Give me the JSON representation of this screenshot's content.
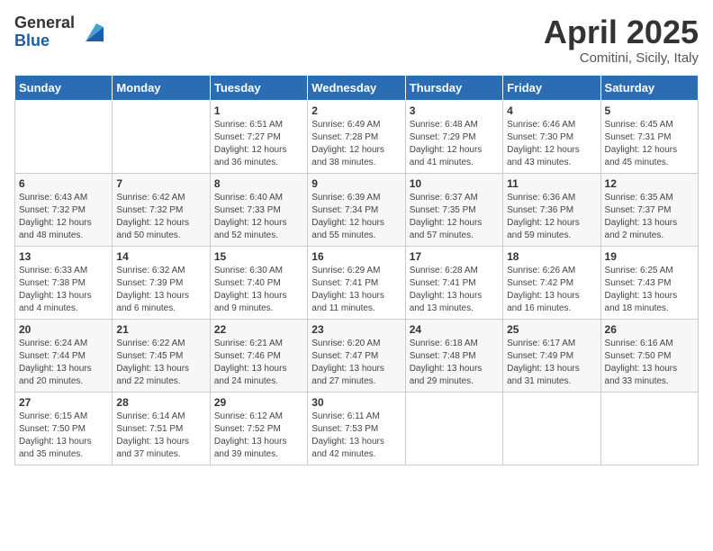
{
  "header": {
    "logo_general": "General",
    "logo_blue": "Blue",
    "month_title": "April 2025",
    "location": "Comitini, Sicily, Italy"
  },
  "days_of_week": [
    "Sunday",
    "Monday",
    "Tuesday",
    "Wednesday",
    "Thursday",
    "Friday",
    "Saturday"
  ],
  "weeks": [
    [
      {
        "day": "",
        "info": ""
      },
      {
        "day": "",
        "info": ""
      },
      {
        "day": "1",
        "info": "Sunrise: 6:51 AM\nSunset: 7:27 PM\nDaylight: 12 hours and 36 minutes."
      },
      {
        "day": "2",
        "info": "Sunrise: 6:49 AM\nSunset: 7:28 PM\nDaylight: 12 hours and 38 minutes."
      },
      {
        "day": "3",
        "info": "Sunrise: 6:48 AM\nSunset: 7:29 PM\nDaylight: 12 hours and 41 minutes."
      },
      {
        "day": "4",
        "info": "Sunrise: 6:46 AM\nSunset: 7:30 PM\nDaylight: 12 hours and 43 minutes."
      },
      {
        "day": "5",
        "info": "Sunrise: 6:45 AM\nSunset: 7:31 PM\nDaylight: 12 hours and 45 minutes."
      }
    ],
    [
      {
        "day": "6",
        "info": "Sunrise: 6:43 AM\nSunset: 7:32 PM\nDaylight: 12 hours and 48 minutes."
      },
      {
        "day": "7",
        "info": "Sunrise: 6:42 AM\nSunset: 7:32 PM\nDaylight: 12 hours and 50 minutes."
      },
      {
        "day": "8",
        "info": "Sunrise: 6:40 AM\nSunset: 7:33 PM\nDaylight: 12 hours and 52 minutes."
      },
      {
        "day": "9",
        "info": "Sunrise: 6:39 AM\nSunset: 7:34 PM\nDaylight: 12 hours and 55 minutes."
      },
      {
        "day": "10",
        "info": "Sunrise: 6:37 AM\nSunset: 7:35 PM\nDaylight: 12 hours and 57 minutes."
      },
      {
        "day": "11",
        "info": "Sunrise: 6:36 AM\nSunset: 7:36 PM\nDaylight: 12 hours and 59 minutes."
      },
      {
        "day": "12",
        "info": "Sunrise: 6:35 AM\nSunset: 7:37 PM\nDaylight: 13 hours and 2 minutes."
      }
    ],
    [
      {
        "day": "13",
        "info": "Sunrise: 6:33 AM\nSunset: 7:38 PM\nDaylight: 13 hours and 4 minutes."
      },
      {
        "day": "14",
        "info": "Sunrise: 6:32 AM\nSunset: 7:39 PM\nDaylight: 13 hours and 6 minutes."
      },
      {
        "day": "15",
        "info": "Sunrise: 6:30 AM\nSunset: 7:40 PM\nDaylight: 13 hours and 9 minutes."
      },
      {
        "day": "16",
        "info": "Sunrise: 6:29 AM\nSunset: 7:41 PM\nDaylight: 13 hours and 11 minutes."
      },
      {
        "day": "17",
        "info": "Sunrise: 6:28 AM\nSunset: 7:41 PM\nDaylight: 13 hours and 13 minutes."
      },
      {
        "day": "18",
        "info": "Sunrise: 6:26 AM\nSunset: 7:42 PM\nDaylight: 13 hours and 16 minutes."
      },
      {
        "day": "19",
        "info": "Sunrise: 6:25 AM\nSunset: 7:43 PM\nDaylight: 13 hours and 18 minutes."
      }
    ],
    [
      {
        "day": "20",
        "info": "Sunrise: 6:24 AM\nSunset: 7:44 PM\nDaylight: 13 hours and 20 minutes."
      },
      {
        "day": "21",
        "info": "Sunrise: 6:22 AM\nSunset: 7:45 PM\nDaylight: 13 hours and 22 minutes."
      },
      {
        "day": "22",
        "info": "Sunrise: 6:21 AM\nSunset: 7:46 PM\nDaylight: 13 hours and 24 minutes."
      },
      {
        "day": "23",
        "info": "Sunrise: 6:20 AM\nSunset: 7:47 PM\nDaylight: 13 hours and 27 minutes."
      },
      {
        "day": "24",
        "info": "Sunrise: 6:18 AM\nSunset: 7:48 PM\nDaylight: 13 hours and 29 minutes."
      },
      {
        "day": "25",
        "info": "Sunrise: 6:17 AM\nSunset: 7:49 PM\nDaylight: 13 hours and 31 minutes."
      },
      {
        "day": "26",
        "info": "Sunrise: 6:16 AM\nSunset: 7:50 PM\nDaylight: 13 hours and 33 minutes."
      }
    ],
    [
      {
        "day": "27",
        "info": "Sunrise: 6:15 AM\nSunset: 7:50 PM\nDaylight: 13 hours and 35 minutes."
      },
      {
        "day": "28",
        "info": "Sunrise: 6:14 AM\nSunset: 7:51 PM\nDaylight: 13 hours and 37 minutes."
      },
      {
        "day": "29",
        "info": "Sunrise: 6:12 AM\nSunset: 7:52 PM\nDaylight: 13 hours and 39 minutes."
      },
      {
        "day": "30",
        "info": "Sunrise: 6:11 AM\nSunset: 7:53 PM\nDaylight: 13 hours and 42 minutes."
      },
      {
        "day": "",
        "info": ""
      },
      {
        "day": "",
        "info": ""
      },
      {
        "day": "",
        "info": ""
      }
    ]
  ]
}
